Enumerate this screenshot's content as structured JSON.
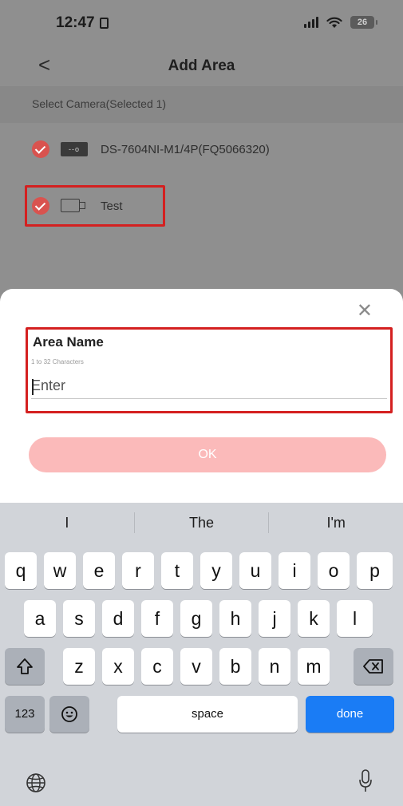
{
  "status": {
    "time": "12:47",
    "battery": "26"
  },
  "nav": {
    "title": "Add Area"
  },
  "select_camera": {
    "label": "Select Camera(Selected 1)"
  },
  "cameras": [
    {
      "name": "DS-7604NI-M1/4P(FQ5066320)",
      "icon": "nvr-icon",
      "badge": "--o"
    },
    {
      "name": "Test",
      "icon": "camera-icon"
    }
  ],
  "sheet": {
    "area_label": "Area Name",
    "hint": "1 to 32 Characters",
    "placeholder": "Enter",
    "ok_label": "OK"
  },
  "keyboard": {
    "suggestions": [
      "I",
      "The",
      "I'm"
    ],
    "row1": [
      "q",
      "w",
      "e",
      "r",
      "t",
      "y",
      "u",
      "i",
      "o",
      "p"
    ],
    "row2": [
      "a",
      "s",
      "d",
      "f",
      "g",
      "h",
      "j",
      "k",
      "l"
    ],
    "row3": [
      "z",
      "x",
      "c",
      "v",
      "b",
      "n",
      "m"
    ],
    "num_label": "123",
    "space_label": "space",
    "done_label": "done"
  },
  "colors": {
    "accent_red": "#d9534f",
    "highlight": "#d42020",
    "ok_button": "#fbbaba",
    "done": "#1a7cf5"
  }
}
